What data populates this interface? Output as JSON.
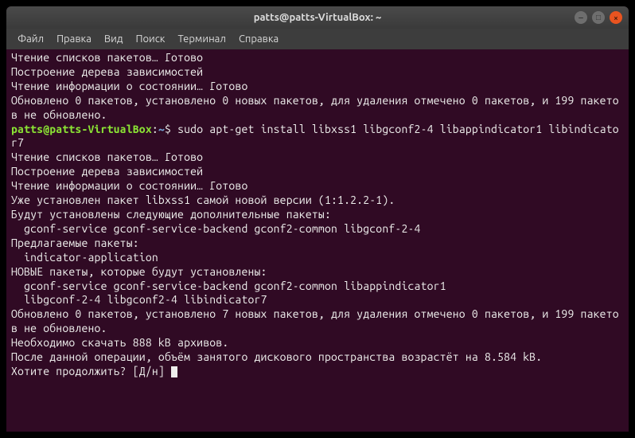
{
  "window": {
    "title": "patts@patts-VirtualBox: ~"
  },
  "menu": {
    "file": "Файл",
    "edit": "Правка",
    "view": "Вид",
    "search": "Поиск",
    "terminal": "Терминал",
    "help": "Справка"
  },
  "output": {
    "l1": "Чтение списков пакетов… Готово",
    "l2": "Построение дерева зависимостей",
    "l3": "Чтение информации о состоянии… Готово",
    "l4": "Обновлено 0 пакетов, установлено 0 новых пакетов, для удаления отмечено 0 пакетов, и 199 пакетов не обновлено.",
    "prompt_user": "patts@patts-VirtualBox",
    "prompt_path": "~",
    "prompt_sep": ":",
    "prompt_dollar": "$ ",
    "command": "sudo apt-get install libxss1 libgconf2-4 libappindicator1 libindicator7",
    "l5": "Чтение списков пакетов… Готово",
    "l6": "Построение дерева зависимостей",
    "l7": "Чтение информации о состоянии… Готово",
    "l8": "Уже установлен пакет libxss1 самой новой версии (1:1.2.2-1).",
    "l9": "Будут установлены следующие дополнительные пакеты:",
    "l10": "  gconf-service gconf-service-backend gconf2-common libgconf-2-4",
    "l11": "Предлагаемые пакеты:",
    "l12": "  indicator-application",
    "l13": "НОВЫЕ пакеты, которые будут установлены:",
    "l14": "  gconf-service gconf-service-backend gconf2-common libappindicator1",
    "l15": "  libgconf-2-4 libgconf2-4 libindicator7",
    "l16": "Обновлено 0 пакетов, установлено 7 новых пакетов, для удаления отмечено 0 пакетов, и 199 пакетов не обновлено.",
    "l17": "Необходимо скачать 888 kB архивов.",
    "l18": "После данной операции, объём занятого дискового пространства возрастёт на 8.584 kB.",
    "l19": "Хотите продолжить? [Д/н] "
  }
}
